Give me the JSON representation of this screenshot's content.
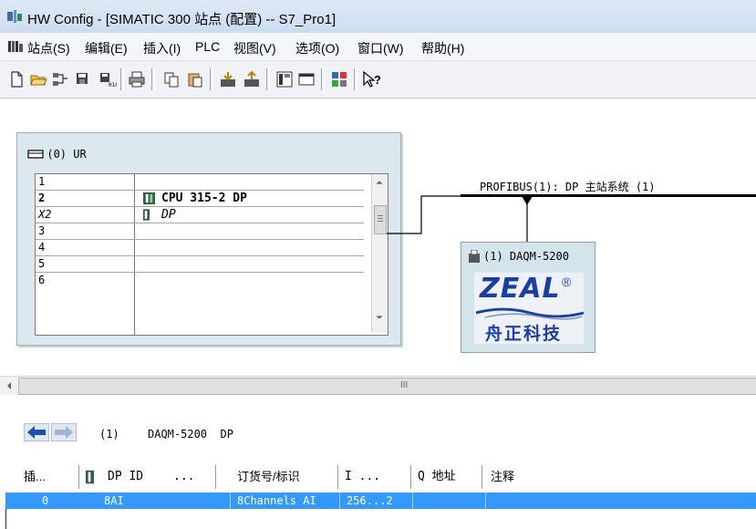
{
  "window": {
    "title": "HW Config - [SIMATIC 300 站点 (配置) -- S7_Pro1]"
  },
  "menu": [
    "站点(S)",
    "编辑(E)",
    "插入(I)",
    "PLC",
    "视图(V)",
    "选项(O)",
    "窗口(W)",
    "帮助(H)"
  ],
  "toolbar": {
    "icons": [
      "new-icon",
      "open-icon",
      "network-icon",
      "save-icon",
      "save-compile-icon",
      "print-icon",
      "copy-icon",
      "paste-icon",
      "download-icon",
      "upload-icon",
      "catalog-icon",
      "window-icon",
      "network-config-icon",
      "help-pointer-icon"
    ]
  },
  "rack": {
    "title": "(0) UR",
    "rows": [
      {
        "slot": "1",
        "module": ""
      },
      {
        "slot": "2",
        "module": "CPU 315-2 DP"
      },
      {
        "slot": "X2",
        "module": "DP"
      },
      {
        "slot": "3",
        "module": ""
      },
      {
        "slot": "4",
        "module": ""
      },
      {
        "slot": "5",
        "module": ""
      },
      {
        "slot": "6",
        "module": ""
      }
    ]
  },
  "profibus": {
    "label": "PROFIBUS(1): DP 主站系统 (1)"
  },
  "station": {
    "label": "(1) DAQM-5200",
    "logo_text": "ZEAL",
    "logo_sub": "舟正科技"
  },
  "hscroll": {
    "thumb": "III"
  },
  "detail": {
    "header_index": "(1)",
    "header_name": "DAQM-5200  DP",
    "columns": [
      "插...",
      "DP ID",
      "...",
      "订货号/标识",
      "I ...",
      "Q 地址",
      "注释"
    ],
    "rows": [
      {
        "slot": "0",
        "dp_id": "8AI",
        "order": "8Channels AI",
        "i_addr": "256...2",
        "q_addr": "",
        "comment": ""
      }
    ]
  },
  "colors": {
    "selection": "#3399ff",
    "rack_bg": "#dbe9ee",
    "station_bg": "#d3e4ea",
    "logo_blue": "#1a3ea8"
  }
}
